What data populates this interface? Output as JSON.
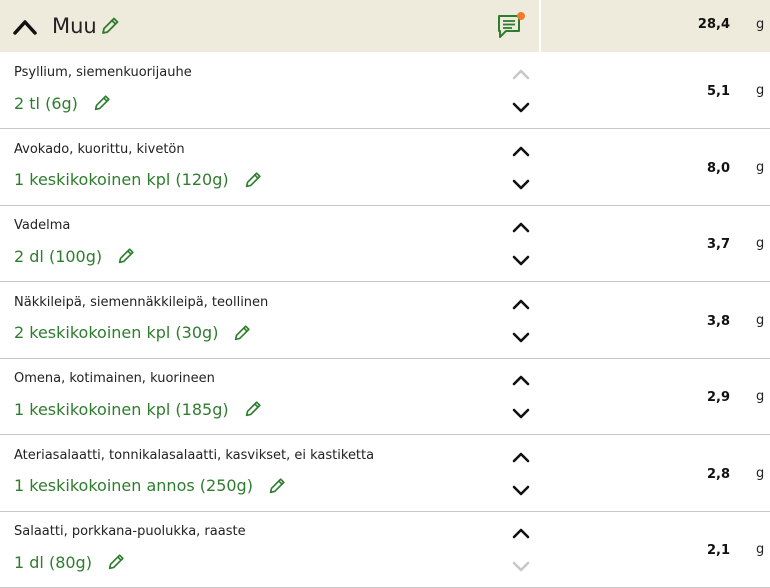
{
  "header": {
    "title": "Muu",
    "total": "28,4",
    "unit": "g",
    "comment_has_notification": true,
    "notification_color": "#f47a2a"
  },
  "colors": {
    "amount_text": "#2e7d2e",
    "header_bg": "#eeeadc",
    "disabled_chevron": "#c8c8c8"
  },
  "items": [
    {
      "name": "Psyllium, siemenkuorijauhe",
      "amount": "2 tl (6g)",
      "value": "5,1",
      "unit": "g",
      "up_enabled": false,
      "down_enabled": true
    },
    {
      "name": "Avokado, kuorittu, kivetön",
      "amount": "1 keskikokoinen kpl (120g)",
      "value": "8,0",
      "unit": "g",
      "up_enabled": true,
      "down_enabled": true
    },
    {
      "name": "Vadelma",
      "amount": "2 dl (100g)",
      "value": "3,7",
      "unit": "g",
      "up_enabled": true,
      "down_enabled": true
    },
    {
      "name": "Näkkileipä, siemennäkkileipä, teollinen",
      "amount": "2 keskikokoinen kpl (30g)",
      "value": "3,8",
      "unit": "g",
      "up_enabled": true,
      "down_enabled": true
    },
    {
      "name": "Omena, kotimainen, kuorineen",
      "amount": "1 keskikokoinen kpl (185g)",
      "value": "2,9",
      "unit": "g",
      "up_enabled": true,
      "down_enabled": true
    },
    {
      "name": "Ateriasalaatti, tonnikalasalaatti, kasvikset, ei kastiketta",
      "amount": "1 keskikokoinen annos (250g)",
      "value": "2,8",
      "unit": "g",
      "up_enabled": true,
      "down_enabled": true
    },
    {
      "name": "Salaatti, porkkana-puolukka, raaste",
      "amount": "1 dl (80g)",
      "value": "2,1",
      "unit": "g",
      "up_enabled": true,
      "down_enabled": false
    }
  ]
}
